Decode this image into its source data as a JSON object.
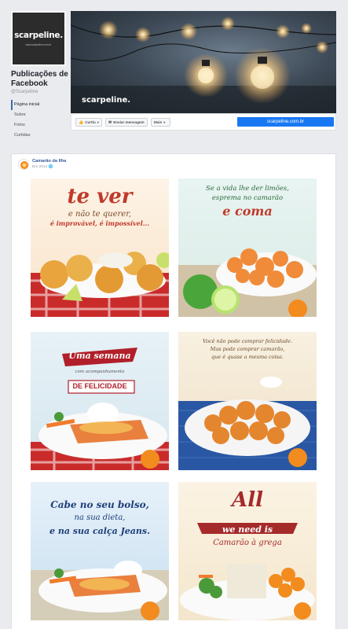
{
  "page": {
    "logo_text": "scarpeline.",
    "logo_url": "www.scarpeline.com.br",
    "title": "Publicações de Facebook",
    "handle": "@Scarpeline",
    "nav": [
      {
        "label": "Página inicial",
        "active": true
      },
      {
        "label": "Sobre"
      },
      {
        "label": "Fotos"
      },
      {
        "label": "Curtidas"
      }
    ]
  },
  "cover": {
    "logo_text": "scarpeline."
  },
  "actions": {
    "like": "Curtiu",
    "message": "Enviar mensagem",
    "more": "Mais",
    "website": "scarpeline.com.br"
  },
  "post": {
    "author": "Camarão da Ilha",
    "time": "Em 2014"
  },
  "tiles": [
    {
      "line1": "te ver",
      "line2": "e não te querer,",
      "line3": "é improvável, é impossível...",
      "brand": "CAMARÃO DA ILHA"
    },
    {
      "line1": "Se a vida lhe der limões,",
      "line2": "esprema no camarão",
      "line3": "e coma",
      "brand": "CAMARÃO DA ILHA"
    },
    {
      "line1": "Uma semana",
      "line2": "com acompanhamento",
      "line3": "DE FELICIDADE",
      "brand": "CAMARÃO DA ILHA"
    },
    {
      "line1": "Você não pode comprar felicidade.",
      "line2": "Mas pode comprar camarão,",
      "line3": "que é quase a mesma coisa.",
      "brand": "CAMARÃO DA ILHA"
    },
    {
      "line1": "Cabe no seu bolso,",
      "line2": "na sua dieta,",
      "line3": "e na sua calça Jeans.",
      "brand": "CAMARÃO DA ILHA"
    },
    {
      "line1": "All",
      "line2": "we need is",
      "line3": "Camarão à grega",
      "brand": "CAMARÃO DA ILHA"
    }
  ],
  "colors": {
    "facebook_blue": "#4267b2",
    "link_blue": "#365899",
    "button_blue": "#1877f2",
    "brand_orange": "#f28c1e"
  }
}
